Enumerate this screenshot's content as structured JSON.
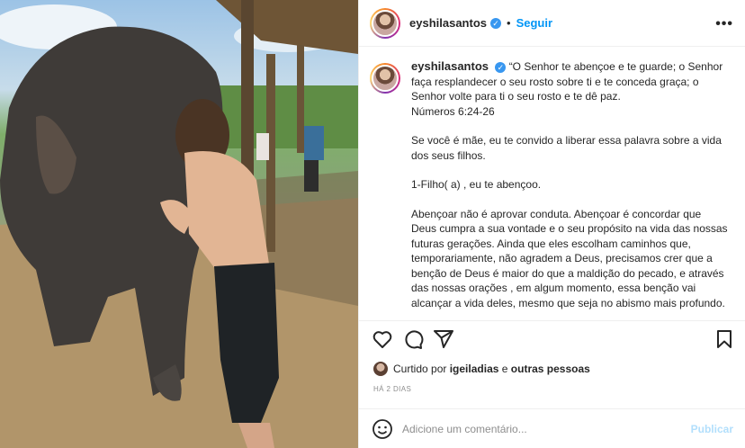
{
  "post": {
    "username": "eyshilasantos",
    "follow_label": "Seguir",
    "more_label": "•••",
    "caption": {
      "p1": "“O Senhor te abençoe e te guarde; o Senhor faça resplandecer o seu rosto sobre ti e te conceda graça; o Senhor volte para ti o seu rosto e te dê paz.",
      "p1_ref": "Números 6:24-26",
      "p2": "Se você é mãe, eu te convido a liberar essa palavra sobre a vida dos seus filhos.",
      "p3": "1-Filho( a) , eu te abençoo.",
      "p4": "Abençoar não é aprovar conduta. Abençoar é concordar que Deus cumpra a sua vontade e o seu propósito na vida das nossas futuras gerações. Ainda que eles escolham caminhos que, temporariamente, não agradem a Deus, precisamos crer que a benção de Deus é maior do que a maldição do pecado, e através das nossas orações , em algum momento, essa benção vai alcançar a vida deles, mesmo que seja no abismo mais profundo."
    },
    "likes": {
      "prefix": "Curtido por",
      "user": "igeiladias",
      "connector": "e",
      "others": "outras pessoas"
    },
    "timestamp": "HÁ 2 DIAS",
    "comment": {
      "placeholder": "Adicione um comentário...",
      "publish_label": "Publicar"
    }
  },
  "colors": {
    "accent": "#0095f6",
    "verified": "#3897f0",
    "publish_disabled": "#b2dffc",
    "muted": "#8e8e8e"
  },
  "icons": [
    "heart-icon",
    "comment-icon",
    "share-icon",
    "bookmark-icon",
    "emoji-icon",
    "verified-icon"
  ]
}
